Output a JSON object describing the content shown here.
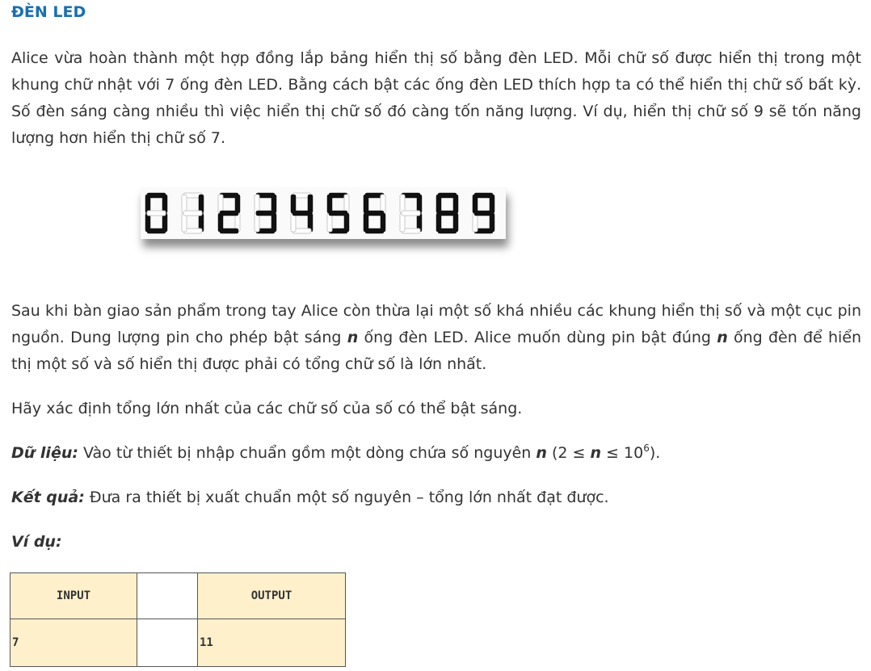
{
  "title": "ĐÈN LED",
  "paragraph1": "Alice vừa hoàn thành một hợp đồng lắp bảng hiển thị số bằng đèn LED. Mỗi chữ số được hiển thị trong một khung chữ nhật với 7 ống đèn LED. Bằng cách bật các ống đèn LED thích hợp ta có thể hiển thị chữ số bất kỳ. Số đèn sáng càng nhiều thì việc hiển thị chữ số đó càng tốn năng lượng. Ví dụ, hiển thị chữ số 9 sẽ tốn năng lượng hơn hiển thị chữ số 7.",
  "led_digits": [
    "0",
    "1",
    "2",
    "3",
    "4",
    "5",
    "6",
    "7",
    "8",
    "9"
  ],
  "led_on_color": "#111111",
  "led_off_color": "#c8c8c8",
  "paragraph2": {
    "part1": "Sau khi bàn giao sản phẩm trong tay Alice còn thừa lại một số khá nhiều các khung hiển thị số và một cục pin nguồn. Dung lượng pin cho phép bật sáng ",
    "var1": "n",
    "part2": " ống đèn LED. Alice muốn dùng pin bật đúng ",
    "var2": "n",
    "part3": " ống đèn để hiển thị một số và số hiển thị được phải có tổng chữ số là lớn nhất."
  },
  "paragraph3": "Hãy xác định tổng lớn nhất của các chữ số của số có thể bật sáng.",
  "input_section": {
    "label": "Dữ liệu:",
    "text1": " Vào từ thiết bị nhập chuẩn gồm một dòng chứa số nguyên ",
    "var": "n",
    "text2": " (2 ≤ ",
    "var2": "n",
    "text3": " ≤ 10",
    "exp": "6",
    "text4": ")."
  },
  "output_section": {
    "label": "Kết quả:",
    "text": " Đưa ra thiết bị xuất chuẩn một số nguyên – tổng lớn nhất đạt được."
  },
  "example_label": "Ví dụ:",
  "sample_table": {
    "header_input": "INPUT",
    "header_output": "OUTPUT",
    "input_value": "7",
    "output_value": "11",
    "header_bg": "#fff0cc"
  }
}
